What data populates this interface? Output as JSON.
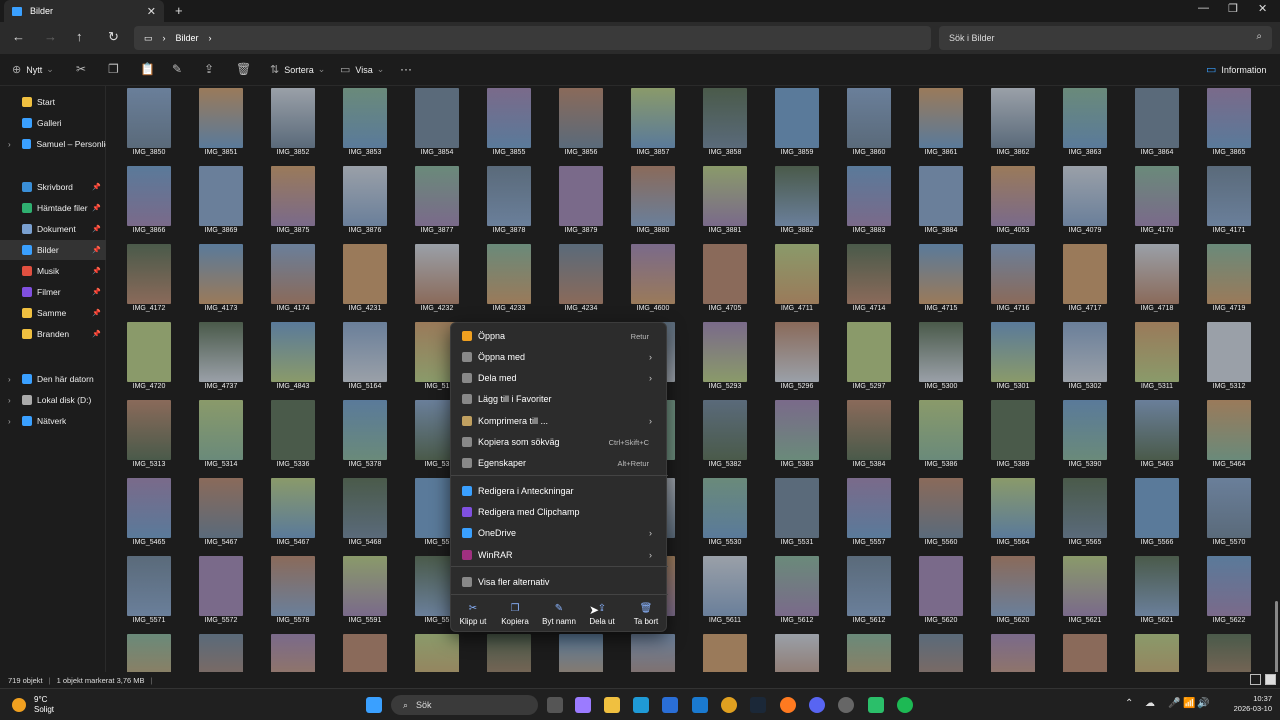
{
  "window": {
    "tab_title": "Bilder",
    "new_tab": "+",
    "min": "—",
    "max": "❐",
    "close": "✕"
  },
  "address": {
    "path": [
      "Bilder"
    ],
    "search_placeholder": "Sök i Bilder"
  },
  "toolbar": {
    "new": "Nytt",
    "sort": "Sortera",
    "view": "Visa",
    "more": "···",
    "info": "Information"
  },
  "sidebar": {
    "items": [
      {
        "label": "Start",
        "icon": "home-icon",
        "color": "#f0c040",
        "pin": false
      },
      {
        "label": "Galleri",
        "icon": "gallery-icon",
        "color": "#3aa0ff",
        "pin": false
      },
      {
        "label": "Samuel – Personlig",
        "icon": "onedrive-icon",
        "color": "#3aa0ff",
        "pin": false,
        "expand": true
      },
      {
        "label": "Skrivbord",
        "icon": "desktop-icon",
        "color": "#3a8fd8",
        "pin": true
      },
      {
        "label": "Hämtade filer",
        "icon": "download-icon",
        "color": "#2fb070",
        "pin": true
      },
      {
        "label": "Dokument",
        "icon": "document-icon",
        "color": "#7aa0d0",
        "pin": true
      },
      {
        "label": "Bilder",
        "icon": "pictures-icon",
        "color": "#3aa0ff",
        "pin": true,
        "selected": true
      },
      {
        "label": "Musik",
        "icon": "music-icon",
        "color": "#e05040",
        "pin": true
      },
      {
        "label": "Filmer",
        "icon": "videos-icon",
        "color": "#8050e0",
        "pin": true
      },
      {
        "label": "Samme",
        "icon": "folder-icon",
        "color": "#f0c040",
        "pin": true
      },
      {
        "label": "Branden",
        "icon": "folder-icon",
        "color": "#f0c040",
        "pin": true
      },
      {
        "label": "Den här datorn",
        "icon": "computer-icon",
        "color": "#3aa0ff",
        "pin": false,
        "expand": true
      },
      {
        "label": "Lokal disk (D:)",
        "icon": "disk-icon",
        "color": "#aaaaaa",
        "pin": false,
        "expand": true
      },
      {
        "label": "Nätverk",
        "icon": "network-icon",
        "color": "#3aa0ff",
        "pin": false,
        "expand": true
      }
    ]
  },
  "rows": [
    [
      "IMG_3850",
      "IMG_3851",
      "IMG_3852",
      "IMG_3853",
      "IMG_3854",
      "IMG_3855",
      "IMG_3856",
      "IMG_3857",
      "IMG_3858",
      "IMG_3859",
      "IMG_3860",
      "IMG_3861",
      "IMG_3862",
      "IMG_3863",
      "IMG_3864",
      "IMG_3865"
    ],
    [
      "IMG_3866",
      "IMG_3869",
      "IMG_3875",
      "IMG_3876",
      "IMG_3877",
      "IMG_3878",
      "IMG_3879",
      "IMG_3880",
      "IMG_3881",
      "IMG_3882",
      "IMG_3883",
      "IMG_3884",
      "IMG_4053",
      "IMG_4079",
      "IMG_4170",
      "IMG_4171"
    ],
    [
      "IMG_4172",
      "IMG_4173",
      "IMG_4174",
      "IMG_4231",
      "IMG_4232",
      "IMG_4233",
      "IMG_4234",
      "IMG_4600",
      "IMG_4705",
      "IMG_4711",
      "IMG_4714",
      "IMG_4715",
      "IMG_4716",
      "IMG_4717",
      "IMG_4718",
      "IMG_4719"
    ],
    [
      "IMG_4720",
      "IMG_4737",
      "IMG_4843",
      "IMG_5164",
      "IMG_51",
      "",
      "",
      "",
      "IMG_5293",
      "IMG_5296",
      "IMG_5297",
      "IMG_5300",
      "IMG_5301",
      "IMG_5302",
      "IMG_5311",
      "IMG_5312"
    ],
    [
      "IMG_5313",
      "IMG_5314",
      "IMG_5336",
      "IMG_5378",
      "IMG_53",
      "",
      "",
      "",
      "IMG_5382",
      "IMG_5383",
      "IMG_5384",
      "IMG_5386",
      "IMG_5389",
      "IMG_5390",
      "IMG_5463",
      "IMG_5464"
    ],
    [
      "IMG_5465",
      "IMG_5467",
      "IMG_5467",
      "IMG_5468",
      "IMG_55",
      "",
      "",
      "",
      "IMG_5530",
      "IMG_5531",
      "IMG_5557",
      "IMG_5560",
      "IMG_5564",
      "IMG_5565",
      "IMG_5566",
      "IMG_5570"
    ],
    [
      "IMG_5571",
      "IMG_5572",
      "IMG_5578",
      "IMG_5591",
      "IMG_55",
      "",
      "",
      "",
      "IMG_5611",
      "IMG_5612",
      "IMG_5612",
      "IMG_5620",
      "IMG_5620",
      "IMG_5621",
      "IMG_5621",
      "IMG_5622"
    ],
    [
      "",
      "",
      "",
      "",
      "",
      "",
      "",
      "",
      "",
      "",
      "",
      "",
      "",
      "",
      "",
      ""
    ]
  ],
  "context_menu": {
    "items": [
      {
        "label": "Öppna",
        "shortcut": "Retur",
        "icon": "open-icon",
        "color": "#f0a020"
      },
      {
        "label": "Öppna med",
        "arrow": true,
        "icon": "open-with-icon",
        "color": "#888888"
      },
      {
        "label": "Dela med",
        "arrow": true,
        "icon": "share-with-icon",
        "color": "#888888"
      },
      {
        "label": "Lägg till i Favoriter",
        "icon": "star-icon",
        "color": "#888888"
      },
      {
        "label": "Komprimera till ...",
        "arrow": true,
        "icon": "zip-icon",
        "color": "#c0a060"
      },
      {
        "label": "Kopiera som sökväg",
        "shortcut": "Ctrl+Skift+C",
        "icon": "copy-path-icon",
        "color": "#888888"
      },
      {
        "label": "Egenskaper",
        "shortcut": "Alt+Retur",
        "icon": "properties-icon",
        "color": "#888888"
      },
      {
        "label": "Redigera i Anteckningar",
        "icon": "notepad-icon",
        "color": "#3aa0ff"
      },
      {
        "label": "Redigera med Clipchamp",
        "icon": "clipchamp-icon",
        "color": "#8050e0"
      },
      {
        "label": "OneDrive",
        "arrow": true,
        "icon": "onedrive-icon",
        "color": "#3aa0ff"
      },
      {
        "label": "WinRAR",
        "arrow": true,
        "icon": "winrar-icon",
        "color": "#a03080"
      },
      {
        "label": "Visa fler alternativ",
        "icon": "more-options-icon",
        "color": "#888888"
      }
    ],
    "quick": [
      {
        "label": "Klipp ut",
        "icon": "cut-icon",
        "glyph": "✂"
      },
      {
        "label": "Kopiera",
        "icon": "copy-icon",
        "glyph": "❐"
      },
      {
        "label": "Byt namn",
        "icon": "rename-icon",
        "glyph": "✎"
      },
      {
        "label": "Dela ut",
        "icon": "share-icon",
        "glyph": "⇪"
      },
      {
        "label": "Ta bort",
        "icon": "delete-icon",
        "glyph": "🗑"
      }
    ]
  },
  "status": {
    "count": "719 objekt",
    "selected": "1 objekt markerat  3,76 MB"
  },
  "taskbar": {
    "temp": "9°C",
    "weather": "Soligt",
    "search": "Sök",
    "time": "10:37",
    "date": "2026-03-10"
  }
}
